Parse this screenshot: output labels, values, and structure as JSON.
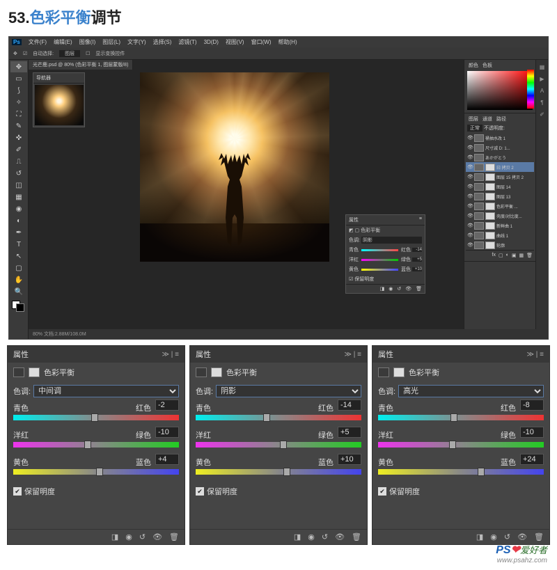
{
  "header": {
    "num": "53.",
    "bold": "色彩平衡",
    "rest": "调节"
  },
  "menu": [
    "文件(F)",
    "编辑(E)",
    "图像(I)",
    "图层(L)",
    "文字(Y)",
    "选择(S)",
    "滤镜(T)",
    "3D(D)",
    "视图(V)",
    "窗口(W)",
    "帮助(H)"
  ],
  "options": {
    "auto": "自动选择:",
    "group": "图层",
    "transform": "显示变换控件"
  },
  "tab": "光芒鹿.psd @ 80% (色彩平衡 1, 图层蒙版/8)",
  "nav_title": "导航器",
  "status": "80%        文档:2.88M/108.0M",
  "prop_panel": {
    "title": "属性",
    "name": "色彩平衡",
    "tone_label": "色调:",
    "tone": "阴影",
    "rows": [
      {
        "l": "青色",
        "r": "红色",
        "v": "-14"
      },
      {
        "l": "洋红",
        "r": "绿色",
        "v": "+5"
      },
      {
        "l": "黄色",
        "r": "蓝色",
        "v": "+10"
      }
    ],
    "preserve": "保留明度"
  },
  "right": {
    "color_tab": "颜色",
    "swatch_tab": "色板",
    "layers_tab": "图层",
    "channels_tab": "通道",
    "paths_tab": "路径",
    "mode": "正常",
    "opacity": "不透明度:",
    "layers": [
      {
        "name": "桶抽水改 1"
      },
      {
        "name": "尺寸减 D: 1..."
      },
      {
        "name": "あかがとう"
      },
      {
        "name": "曰 拷贝 2",
        "sel": true
      },
      {
        "name": "图层 15 拷贝 2"
      },
      {
        "name": "图层 14"
      },
      {
        "name": "图层 13"
      },
      {
        "name": "色彩平衡 ..."
      },
      {
        "name": "壳度/对比度..."
      },
      {
        "name": "新鲜曲 1"
      },
      {
        "name": "曲线 1"
      },
      {
        "name": "轮廓"
      }
    ]
  },
  "panels_common": {
    "title": "属性",
    "name": "色彩平衡",
    "tone_label": "色调:",
    "cyan": "青色",
    "red": "红色",
    "magenta": "洋红",
    "green": "绿色",
    "yellow": "黄色",
    "blue": "蓝色",
    "preserve": "保留明度"
  },
  "chart_data": [
    {
      "type": "table",
      "title": "色彩平衡 — 中间调",
      "tone": "中间调",
      "rows": [
        {
          "axis": "青色-红色",
          "value": -2
        },
        {
          "axis": "洋红-绿色",
          "value": -10
        },
        {
          "axis": "黄色-蓝色",
          "value": 4
        }
      ],
      "preserve_luminosity": true,
      "range": [
        -100,
        100
      ]
    },
    {
      "type": "table",
      "title": "色彩平衡 — 阴影",
      "tone": "阴影",
      "rows": [
        {
          "axis": "青色-红色",
          "value": -14
        },
        {
          "axis": "洋红-绿色",
          "value": 5
        },
        {
          "axis": "黄色-蓝色",
          "value": 10
        }
      ],
      "preserve_luminosity": true,
      "range": [
        -100,
        100
      ]
    },
    {
      "type": "table",
      "title": "色彩平衡 — 高光",
      "tone": "高光",
      "rows": [
        {
          "axis": "青色-红色",
          "value": -8
        },
        {
          "axis": "洋红-绿色",
          "value": -10
        },
        {
          "axis": "黄色-蓝色",
          "value": 24
        }
      ],
      "preserve_luminosity": true,
      "range": [
        -100,
        100
      ]
    }
  ],
  "panels": [
    {
      "tone": "中间调",
      "v": [
        "-2",
        "-10",
        "+4"
      ],
      "pos": [
        49,
        45,
        52
      ]
    },
    {
      "tone": "阴影",
      "v": [
        "-14",
        "+5",
        "+10"
      ],
      "pos": [
        43,
        53,
        55
      ]
    },
    {
      "tone": "高光",
      "v": [
        "-8",
        "-10",
        "+24"
      ],
      "pos": [
        46,
        45,
        62
      ]
    }
  ],
  "watermark": {
    "p": "PS",
    "t": "爱好者",
    "u": "www.psahz.com"
  }
}
